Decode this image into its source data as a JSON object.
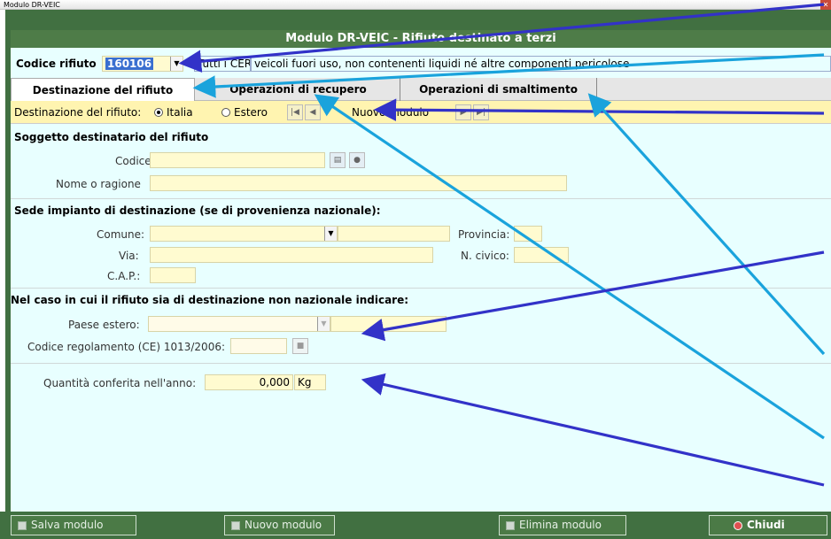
{
  "window": {
    "title": "Modulo DR-VEIC"
  },
  "header": {
    "title": "Modulo DR-VEIC - Rifiuto destinato a terzi"
  },
  "codice": {
    "label": "Codice rifiuto",
    "value": "160106",
    "cer_label": "Tutti i CER",
    "description": "veicoli fuori uso, non contenenti liquidi né altre componenti pericolose"
  },
  "tabs": [
    {
      "label": "Destinazione del rifiuto"
    },
    {
      "label": "Operazioni di recupero"
    },
    {
      "label": "Operazioni di smaltimento"
    }
  ],
  "nav": {
    "label": "Destinazione del rifiuto:",
    "opt_italia": "Italia",
    "opt_estero": "Estero",
    "selected": "Italia",
    "module_label": "Nuovo modulo"
  },
  "soggetto": {
    "section": "Soggetto destinatario del rifiuto",
    "codice_fiscale_label": "Codice fiscale:",
    "codice_fiscale_value": "",
    "nome_label": "Nome o ragione",
    "nome_value": ""
  },
  "sede": {
    "section": "Sede impianto di destinazione (se di provenienza nazionale):",
    "comune_label": "Comune:",
    "comune_value": "",
    "provincia_label": "Provincia:",
    "via_label": "Via:",
    "civico_label": "N. civico:",
    "cap_label": "C.A.P.:"
  },
  "estero": {
    "section": "Nel caso in cui il rifiuto sia di destinazione non nazionale indicare:",
    "paese_label": "Paese estero:",
    "regolamento_label": "Codice regolamento (CE) 1013/2006:"
  },
  "quantita": {
    "label": "Quantità conferita nell'anno:",
    "value": "0,000",
    "unit": "Kg"
  },
  "footer": {
    "salva": "Salva modulo",
    "nuovo": "Nuovo modulo",
    "elimina": "Elimina modulo",
    "chiudi": "Chiudi"
  },
  "colors": {
    "arrow_dark": "#3232c8",
    "arrow_light": "#1aa3dc",
    "header_green": "#4e7c48",
    "content_bg": "#e8ffff",
    "field_bg": "#fffbd0"
  }
}
